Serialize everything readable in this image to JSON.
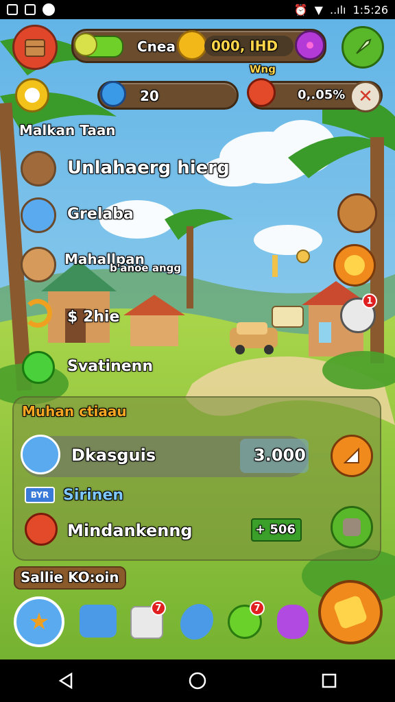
{
  "status_bar": {
    "time": "1:5:26",
    "signal": "..ılı"
  },
  "top_bar": {
    "resource_label": "Cnea",
    "coins": "000, IHD",
    "energy": "20",
    "event_label": "Wng",
    "event_percent": "0,.05%"
  },
  "quests": [
    {
      "label": "Malkan Taan",
      "icon": "flower-icon"
    },
    {
      "label": "Unlahaerg hierg",
      "icon": "chest-avatar-icon"
    },
    {
      "label": "Grelaba",
      "icon": "hero-avatar-icon"
    },
    {
      "label": "Mahallpan",
      "sub": "b'anoe angg",
      "icon": "villager-avatar-icon"
    },
    {
      "label": "$ 2hie",
      "icon": "horseshoe-icon"
    },
    {
      "label": "Svatinenn",
      "icon": "slime-icon"
    }
  ],
  "panel": {
    "title": "Muhan ctiaau",
    "row1": {
      "label": "Dkasguis",
      "value": "3.000"
    },
    "section_tag": "BYR",
    "section_label": "Sirinen",
    "row2": {
      "label": "Mindankenng",
      "value": "+ 506"
    }
  },
  "bottom": {
    "label": "Sallie KO:oin",
    "badges": [
      "7",
      "7"
    ]
  },
  "side_badge": "1",
  "colors": {
    "sky": "#7cc3e8",
    "grass": "#8fc63c",
    "wood": "#6b4d2e",
    "orange_button": "#f08a1c",
    "green_button": "#59b82a",
    "red_button": "#e0462a"
  }
}
